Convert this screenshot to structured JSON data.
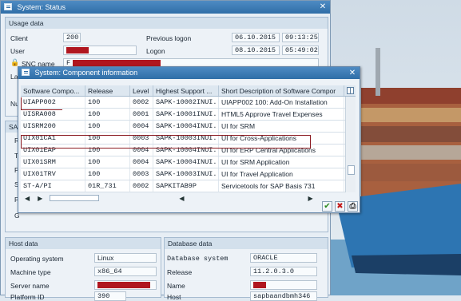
{
  "status_window": {
    "title": "System: Status",
    "usage_data": {
      "heading": "Usage data",
      "client_label": "Client",
      "client_value": "200",
      "user_label": "User",
      "snc_label": "SNC name",
      "snc_prefix": "F",
      "prev_logon_label": "Previous logon",
      "prev_logon_date": "06.10.2015",
      "prev_logon_time": "09:13:25",
      "logon_label": "Logon",
      "logon_date": "08.10.2015",
      "logon_time": "05:49:02",
      "partial_label_la": "La",
      "partial_label_nu": "Nu"
    },
    "sap_section": {
      "partial_heading": "SA",
      "row_letters": [
        "R",
        "T",
        "P",
        "S",
        "P",
        "G"
      ]
    },
    "host_data": {
      "heading": "Host data",
      "os_label": "Operating system",
      "os_value": "Linux",
      "machine_label": "Machine type",
      "machine_value": "x86_64",
      "server_label": "Server name",
      "platform_label": "Platform ID",
      "platform_value": "390"
    },
    "database_data": {
      "heading": "Database data",
      "dbsys_label": "Database system",
      "dbsys_value": "ORACLE",
      "release_label": "Release",
      "release_value": "11.2.0.3.0",
      "name_label": "Name",
      "host_label": "Host",
      "host_value": "sapbaandbmh346"
    }
  },
  "component_dialog": {
    "title": "System: Component information",
    "columns": [
      "Software Compo...",
      "Release",
      "Level",
      "Highest Support ...",
      "Short Description of Software Compor"
    ],
    "rows": [
      {
        "component": "UIAPP002",
        "release": "100",
        "level": "0002",
        "support": "SAPK-10002INUI...",
        "description": "UIAPP002 100: Add-On Installation"
      },
      {
        "component": "UISRA008",
        "release": "100",
        "level": "0001",
        "support": "SAPK-10001INUI...",
        "description": "HTML5 Approve Travel Expenses"
      },
      {
        "component": "UISRM200",
        "release": "100",
        "level": "0004",
        "support": "SAPK-10004INUI...",
        "description": "UI for SRM"
      },
      {
        "component": "UIX01CA1",
        "release": "100",
        "level": "0003",
        "support": "SAPK-10003INUI...",
        "description": "UI for Cross-Applications"
      },
      {
        "component": "UIX01EAP",
        "release": "100",
        "level": "0004",
        "support": "SAPK-10004INUI...",
        "description": "UI for ERP Central Applications"
      },
      {
        "component": "UIX01SRM",
        "release": "100",
        "level": "0004",
        "support": "SAPK-10004INUI...",
        "description": "UI for SRM Application"
      },
      {
        "component": "UIX01TRV",
        "release": "100",
        "level": "0003",
        "support": "SAPK-10003INUI...",
        "description": "UI for Travel Application"
      },
      {
        "component": "ST-A/PI",
        "release": "01R_731",
        "level": "0002",
        "support": "SAPKITAB9P",
        "description": "Servicetools for SAP Basis 731"
      }
    ],
    "buttons": {
      "ok": "✔",
      "cancel": "✖",
      "print": "⎙"
    }
  },
  "colors": {
    "title_blue": "#3a79b4",
    "highlight_red": "#8b1b22",
    "sea_blue": "#6fa3c8"
  }
}
